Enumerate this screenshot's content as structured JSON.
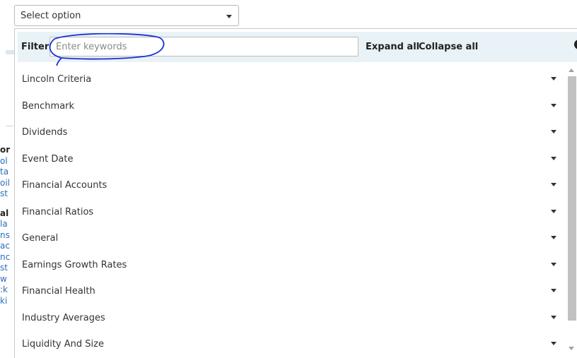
{
  "select": {
    "value": "Select option"
  },
  "filter": {
    "label": "Filter:",
    "placeholder": "Enter keywords",
    "expand_all": "Expand all",
    "collapse_all": "Collapse all",
    "close_icon": "×"
  },
  "categories": [
    {
      "label": "Lincoln Criteria"
    },
    {
      "label": "Benchmark"
    },
    {
      "label": "Dividends"
    },
    {
      "label": "Event Date"
    },
    {
      "label": "Financial Accounts"
    },
    {
      "label": "Financial Ratios"
    },
    {
      "label": "General"
    },
    {
      "label": "Earnings Growth Rates"
    },
    {
      "label": "Financial Health"
    },
    {
      "label": "Industry Averages"
    },
    {
      "label": "Liquidity And Size"
    }
  ],
  "background_fragments": [
    {
      "text": "or",
      "style": "hd"
    },
    {
      "text": "ol",
      "style": "ln"
    },
    {
      "text": "ta",
      "style": "ln"
    },
    {
      "text": "oil",
      "style": "ln"
    },
    {
      "text": "st",
      "style": "ln"
    },
    {
      "text": "",
      "style": "gap"
    },
    {
      "text": "al",
      "style": "hd"
    },
    {
      "text": "la",
      "style": "ln"
    },
    {
      "text": "ns",
      "style": "ln"
    },
    {
      "text": "ac",
      "style": "ln"
    },
    {
      "text": "nc",
      "style": "ln"
    },
    {
      "text": "st",
      "style": "ln"
    },
    {
      "text": "w",
      "style": "ln"
    },
    {
      "text": ":k",
      "style": "ln"
    },
    {
      "text": "ki",
      "style": "ln"
    }
  ],
  "colors": {
    "filter_bar": "#e9f2f7",
    "annotation_circle": "#1a2fd6",
    "link_text": "#2a6ebb"
  }
}
